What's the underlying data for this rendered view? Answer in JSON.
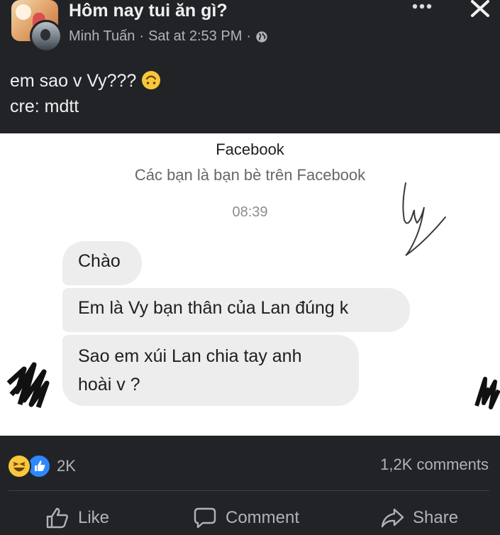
{
  "post": {
    "group_name": "Hôm nay tui ăn gì?",
    "author": "Minh Tuấn",
    "time": "Sat at 2:53 PM",
    "separator": "·",
    "text_line1": "em sao v Vy???",
    "text_line2": "cre: mdtt"
  },
  "screenshot": {
    "title": "Facebook",
    "subtitle": "Các bạn là bạn bè trên Facebook",
    "time": "08:39",
    "messages": [
      {
        "line1": "Chào"
      },
      {
        "line1": "Em là Vy bạn thân của Lan đúng k"
      },
      {
        "line1": "Sao em xúi Lan chia tay anh",
        "line2": "hoài v ?"
      }
    ]
  },
  "stats": {
    "reaction_count": "2K",
    "comments": "1,2K comments"
  },
  "actions": {
    "like": "Like",
    "comment": "Comment",
    "share": "Share"
  },
  "colors": {
    "background": "#222327",
    "text": "#e6e7ea",
    "muted": "#b0b3b8",
    "bubble": "#ededed",
    "like_blue": "#2d88ff",
    "haha_yellow": "#f7c73c"
  },
  "icons": [
    "more-icon",
    "close-icon",
    "globe-icon",
    "upside-down-face-emoji",
    "haha-reaction-icon",
    "like-reaction-icon",
    "thumbs-up-icon",
    "comment-icon",
    "share-icon"
  ]
}
